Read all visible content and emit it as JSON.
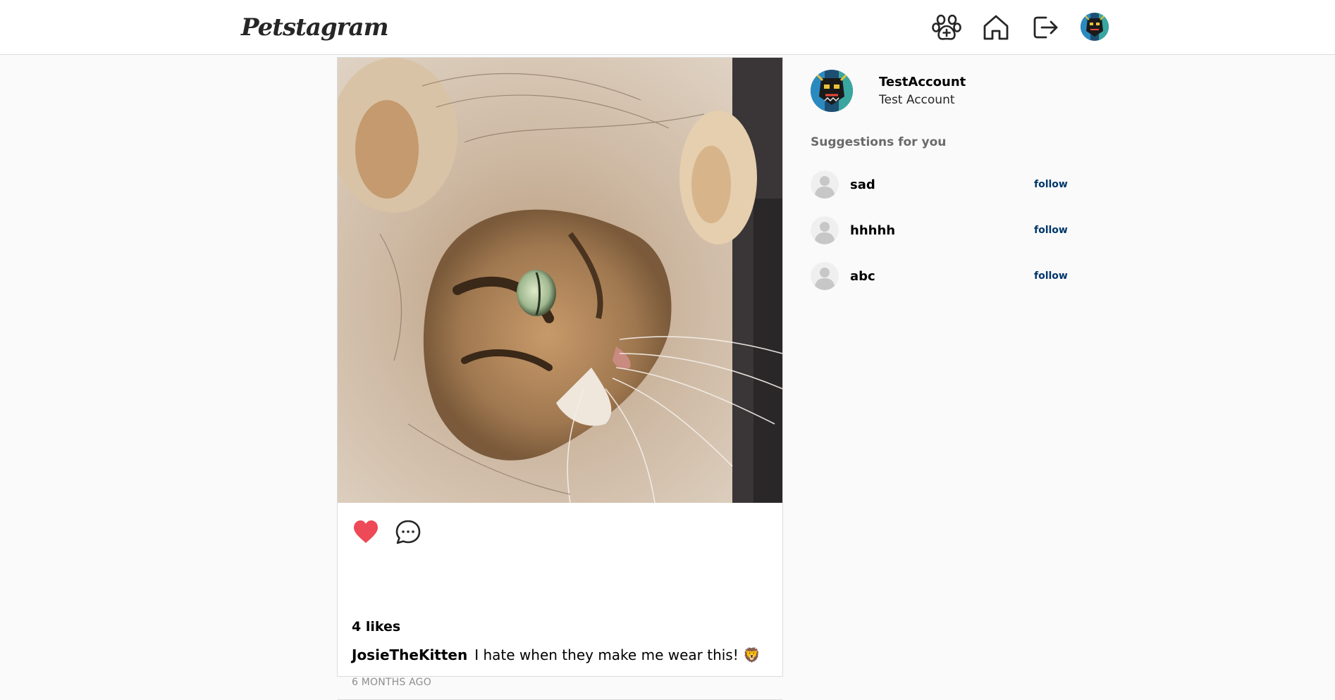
{
  "header": {
    "logo": "Petstagram",
    "icons": [
      "paw-add-icon",
      "home-icon",
      "logout-icon",
      "avatar"
    ]
  },
  "post": {
    "image": "cat-in-lion-mane",
    "likes": "4 likes",
    "username": "JosieTheKitten",
    "caption": "I hate when they make me wear this! 🦁",
    "time": "6 MONTHS AGO",
    "liked": true,
    "colors": {
      "heart": "#ed4956"
    }
  },
  "sidebar": {
    "username": "TestAccount",
    "fullname": "Test Account",
    "suggestions_title": "Suggestions for you",
    "suggestions": [
      {
        "name": "sad",
        "action": "follow"
      },
      {
        "name": "hhhhh",
        "action": "follow"
      },
      {
        "name": "abc",
        "action": "follow"
      }
    ],
    "colors": {
      "follow": "#00376b"
    }
  }
}
